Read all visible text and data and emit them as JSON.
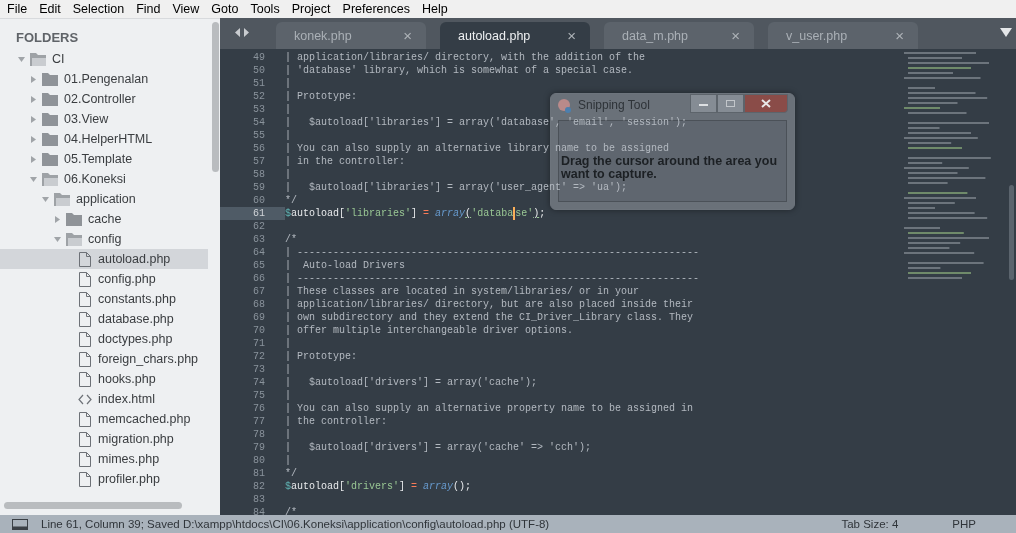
{
  "menu_bar": [
    "File",
    "Edit",
    "Selection",
    "Find",
    "View",
    "Goto",
    "Tools",
    "Project",
    "Preferences",
    "Help"
  ],
  "sidebar": {
    "heading": "FOLDERS",
    "tree": [
      {
        "name": "CI",
        "kind": "folder",
        "expanded": true,
        "selected": false,
        "children": [
          {
            "name": "01.Pengenalan",
            "kind": "folder",
            "expanded": false,
            "selected": false
          },
          {
            "name": "02.Controller",
            "kind": "folder",
            "expanded": false,
            "selected": false
          },
          {
            "name": "03.View",
            "kind": "folder",
            "expanded": false,
            "selected": false
          },
          {
            "name": "04.HelperHTML",
            "kind": "folder",
            "expanded": false,
            "selected": false
          },
          {
            "name": "05.Template",
            "kind": "folder",
            "expanded": false,
            "selected": false
          },
          {
            "name": "06.Koneksi",
            "kind": "folder",
            "expanded": true,
            "selected": false,
            "children": [
              {
                "name": "application",
                "kind": "folder",
                "expanded": true,
                "selected": false,
                "children": [
                  {
                    "name": "cache",
                    "kind": "folder",
                    "expanded": false,
                    "selected": false
                  },
                  {
                    "name": "config",
                    "kind": "folder",
                    "expanded": true,
                    "selected": false,
                    "children": [
                      {
                        "name": "autoload.php",
                        "kind": "file",
                        "selected": true
                      },
                      {
                        "name": "config.php",
                        "kind": "file",
                        "selected": false
                      },
                      {
                        "name": "constants.php",
                        "kind": "file",
                        "selected": false
                      },
                      {
                        "name": "database.php",
                        "kind": "file",
                        "selected": false
                      },
                      {
                        "name": "doctypes.php",
                        "kind": "file",
                        "selected": false
                      },
                      {
                        "name": "foreign_chars.php",
                        "kind": "file",
                        "selected": false
                      },
                      {
                        "name": "hooks.php",
                        "kind": "file",
                        "selected": false
                      },
                      {
                        "name": "index.html",
                        "kind": "markup",
                        "selected": false
                      },
                      {
                        "name": "memcached.php",
                        "kind": "file",
                        "selected": false
                      },
                      {
                        "name": "migration.php",
                        "kind": "file",
                        "selected": false
                      },
                      {
                        "name": "mimes.php",
                        "kind": "file",
                        "selected": false
                      },
                      {
                        "name": "profiler.php",
                        "kind": "file",
                        "selected": false
                      }
                    ]
                  }
                ]
              }
            ]
          }
        ]
      }
    ]
  },
  "tabs": [
    {
      "label": "konek.php",
      "selected": false,
      "close": "×"
    },
    {
      "label": "autoload.php",
      "selected": true,
      "close": "×"
    },
    {
      "label": "data_m.php",
      "selected": false,
      "close": "×"
    },
    {
      "label": "v_user.php",
      "selected": false,
      "close": "×"
    }
  ],
  "editor": {
    "lines": [
      {
        "number": "49",
        "current": false,
        "segments": [
          {
            "kind": "comment",
            "text": "| application/libraries/ directory, with the addition of the"
          }
        ]
      },
      {
        "number": "50",
        "current": false,
        "segments": [
          {
            "kind": "comment",
            "text": "| 'database' library, which is somewhat of a special case."
          }
        ]
      },
      {
        "number": "51",
        "current": false,
        "segments": [
          {
            "kind": "comment",
            "text": "|"
          }
        ]
      },
      {
        "number": "52",
        "current": false,
        "segments": [
          {
            "kind": "comment",
            "text": "| Prototype:"
          }
        ]
      },
      {
        "number": "53",
        "current": false,
        "segments": [
          {
            "kind": "comment",
            "text": "|"
          }
        ]
      },
      {
        "number": "54",
        "current": false,
        "segments": [
          {
            "kind": "comment",
            "text": "|   $autoload['libraries'] = array('database', 'email', 'session');"
          }
        ]
      },
      {
        "number": "55",
        "current": false,
        "segments": [
          {
            "kind": "comment",
            "text": "|"
          }
        ]
      },
      {
        "number": "56",
        "current": false,
        "segments": [
          {
            "kind": "comment",
            "text": "| You can also supply an alternative library name to be assigned"
          }
        ]
      },
      {
        "number": "57",
        "current": false,
        "segments": [
          {
            "kind": "comment",
            "text": "| in the controller:"
          }
        ]
      },
      {
        "number": "58",
        "current": false,
        "segments": [
          {
            "kind": "comment",
            "text": "|"
          }
        ]
      },
      {
        "number": "59",
        "current": false,
        "segments": [
          {
            "kind": "comment",
            "text": "|   $autoload['libraries'] = array('user_agent' => 'ua');"
          }
        ]
      },
      {
        "number": "60",
        "current": false,
        "segments": [
          {
            "kind": "comment",
            "text": "*/"
          }
        ]
      },
      {
        "number": "61",
        "current": true,
        "segments": [
          {
            "kind": "var",
            "text": "$"
          },
          {
            "kind": "ident",
            "text": "autoload"
          },
          {
            "kind": "punct",
            "text": "["
          },
          {
            "kind": "string",
            "text": "'libraries'"
          },
          {
            "kind": "punct",
            "text": "] "
          },
          {
            "kind": "op",
            "text": "= "
          },
          {
            "kind": "func",
            "text": "array"
          },
          {
            "kind": "match",
            "text": "("
          },
          {
            "kind": "string",
            "text": "'databa"
          },
          {
            "kind": "caret"
          },
          {
            "kind": "string",
            "text": "se'"
          },
          {
            "kind": "match",
            "text": ")"
          },
          {
            "kind": "punct",
            "text": ";"
          }
        ]
      },
      {
        "number": "62",
        "current": false
      },
      {
        "number": "63",
        "current": false,
        "segments": [
          {
            "kind": "comment",
            "text": "/*"
          }
        ]
      },
      {
        "number": "64",
        "current": false,
        "segments": [
          {
            "kind": "comment",
            "text": "| -------------------------------------------------------------------"
          }
        ]
      },
      {
        "number": "65",
        "current": false,
        "segments": [
          {
            "kind": "comment",
            "text": "|  Auto-load Drivers"
          }
        ]
      },
      {
        "number": "66",
        "current": false,
        "segments": [
          {
            "kind": "comment",
            "text": "| -------------------------------------------------------------------"
          }
        ]
      },
      {
        "number": "67",
        "current": false,
        "segments": [
          {
            "kind": "comment",
            "text": "| These classes are located in system/libraries/ or in your"
          }
        ]
      },
      {
        "number": "68",
        "current": false,
        "segments": [
          {
            "kind": "comment",
            "text": "| application/libraries/ directory, but are also placed inside their"
          }
        ]
      },
      {
        "number": "69",
        "current": false,
        "segments": [
          {
            "kind": "comment",
            "text": "| own subdirectory and they extend the CI_Driver_Library class. They"
          }
        ]
      },
      {
        "number": "70",
        "current": false,
        "segments": [
          {
            "kind": "comment",
            "text": "| offer multiple interchangeable driver options."
          }
        ]
      },
      {
        "number": "71",
        "current": false,
        "segments": [
          {
            "kind": "comment",
            "text": "|"
          }
        ]
      },
      {
        "number": "72",
        "current": false,
        "segments": [
          {
            "kind": "comment",
            "text": "| Prototype:"
          }
        ]
      },
      {
        "number": "73",
        "current": false,
        "segments": [
          {
            "kind": "comment",
            "text": "|"
          }
        ]
      },
      {
        "number": "74",
        "current": false,
        "segments": [
          {
            "kind": "comment",
            "text": "|   $autoload['drivers'] = array('cache');"
          }
        ]
      },
      {
        "number": "75",
        "current": false,
        "segments": [
          {
            "kind": "comment",
            "text": "|"
          }
        ]
      },
      {
        "number": "76",
        "current": false,
        "segments": [
          {
            "kind": "comment",
            "text": "| You can also supply an alternative property name to be assigned in"
          }
        ]
      },
      {
        "number": "77",
        "current": false,
        "segments": [
          {
            "kind": "comment",
            "text": "| the controller:"
          }
        ]
      },
      {
        "number": "78",
        "current": false,
        "segments": [
          {
            "kind": "comment",
            "text": "|"
          }
        ]
      },
      {
        "number": "79",
        "current": false,
        "segments": [
          {
            "kind": "comment",
            "text": "|   $autoload['drivers'] = array('cache' => 'cch');"
          }
        ]
      },
      {
        "number": "80",
        "current": false,
        "segments": [
          {
            "kind": "comment",
            "text": "|"
          }
        ]
      },
      {
        "number": "81",
        "current": false,
        "segments": [
          {
            "kind": "comment",
            "text": "*/"
          }
        ]
      },
      {
        "number": "82",
        "current": false,
        "segments": [
          {
            "kind": "var",
            "text": "$"
          },
          {
            "kind": "ident",
            "text": "autoload"
          },
          {
            "kind": "punct",
            "text": "["
          },
          {
            "kind": "string",
            "text": "'drivers'"
          },
          {
            "kind": "punct",
            "text": "] "
          },
          {
            "kind": "op",
            "text": "= "
          },
          {
            "kind": "func",
            "text": "array"
          },
          {
            "kind": "punct",
            "text": "();"
          }
        ]
      },
      {
        "number": "83",
        "current": false
      },
      {
        "number": "84",
        "current": false,
        "segments": [
          {
            "kind": "comment",
            "text": "/*"
          }
        ]
      }
    ]
  },
  "snipping_tool": {
    "title": "Snipping Tool",
    "message": "Drag the cursor around the area you want to capture."
  },
  "status_bar": {
    "message": "Line 61, Column 39; Saved D:\\xampp\\htdocs\\CI\\06.Koneksi\\application\\config\\autoload.php (UTF-8)",
    "tab_size": "Tab Size: 4",
    "syntax": "PHP"
  }
}
